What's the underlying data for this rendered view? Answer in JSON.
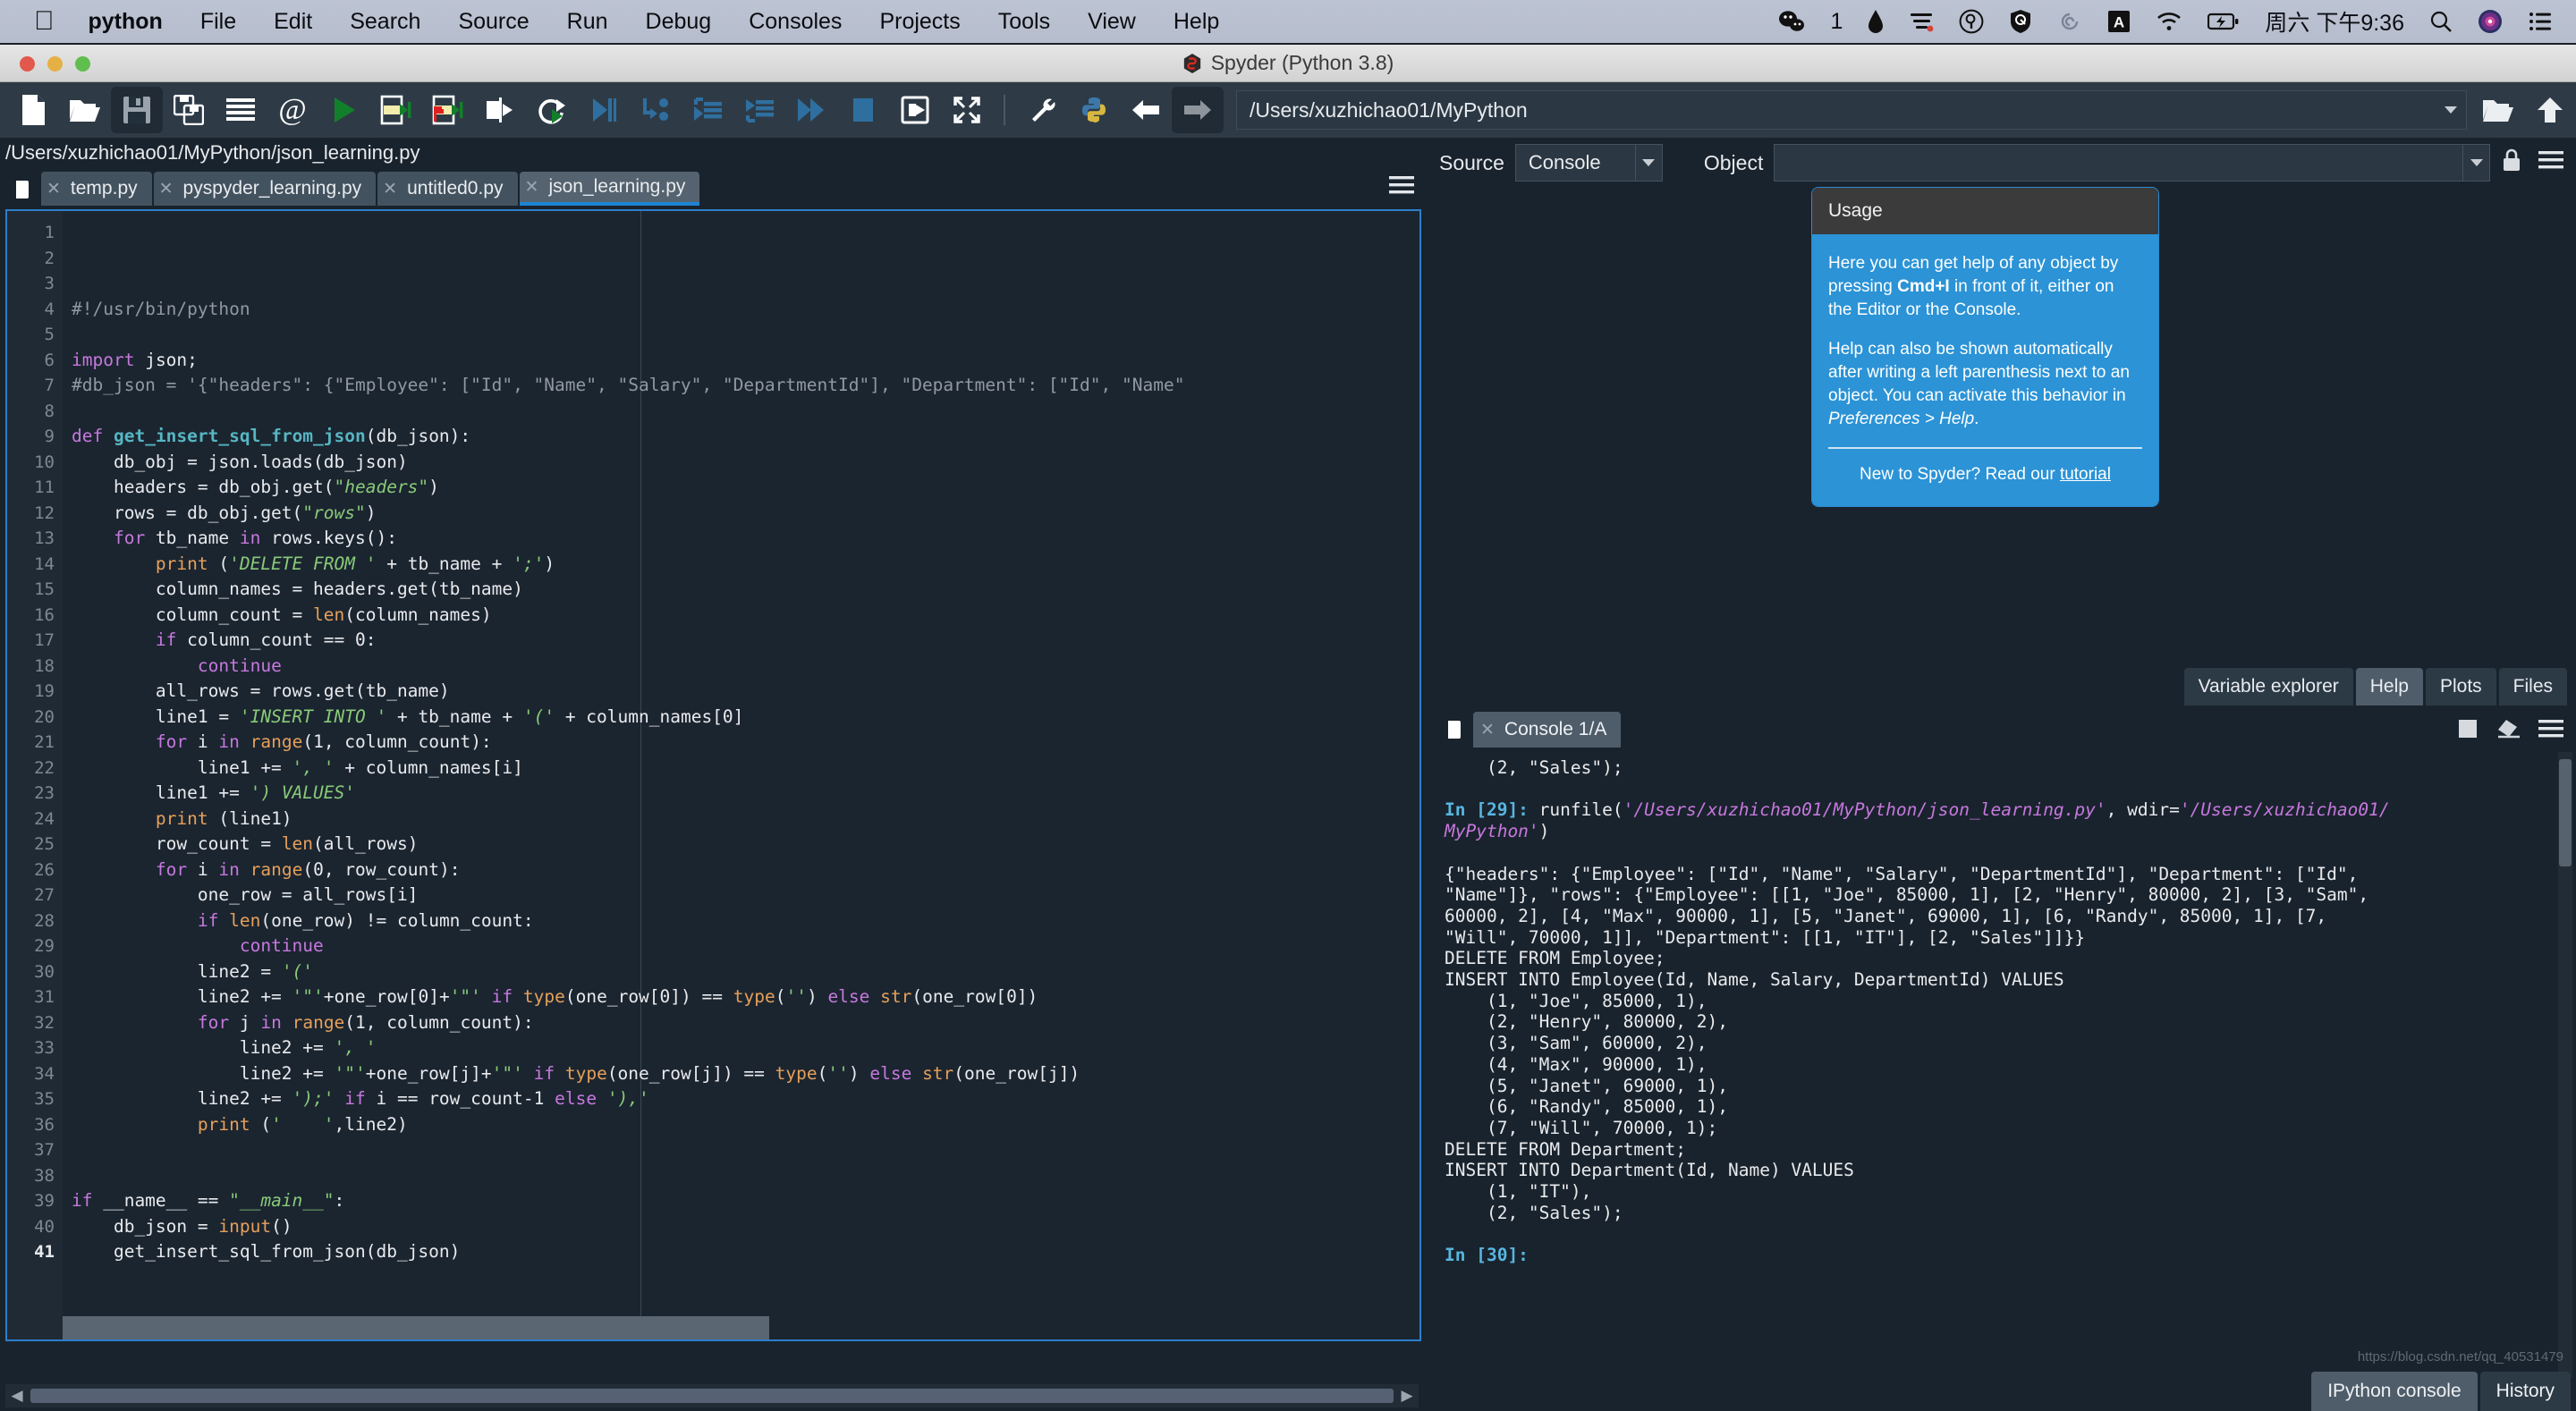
{
  "macos_menubar": {
    "apple_icon": "apple-logo-icon",
    "items": [
      "python",
      "File",
      "Edit",
      "Search",
      "Source",
      "Run",
      "Debug",
      "Consoles",
      "Projects",
      "Tools",
      "View",
      "Help"
    ],
    "tray": {
      "wechat_badge": "1",
      "icons": [
        "wechat-icon",
        "ink-drop-icon",
        "sogou-input-icon",
        "magnifier-badge-icon",
        "shield-icon",
        "spiral-icon",
        "input-source-A-icon",
        "wifi-icon",
        "battery-charging-icon"
      ],
      "clock": "周六 下午9:36",
      "right_icons": [
        "spotlight-search-icon",
        "siri-icon",
        "control-center-icon"
      ]
    }
  },
  "window": {
    "title": "Spyder (Python 3.8)",
    "traffic_lights": [
      "close",
      "minimize",
      "zoom"
    ]
  },
  "toolbar": {
    "buttons": [
      "new-file-icon",
      "open-file-icon",
      "save-file-icon",
      "save-all-icon",
      "file-switcher-icon",
      "find-symbol-icon",
      "run-file-icon",
      "run-cell-icon",
      "run-cell-advance-icon",
      "run-selection-icon",
      "rerun-last-cell-icon",
      "debug-file-icon",
      "step-into-icon",
      "step-return-icon",
      "step-over-icon",
      "continue-icon",
      "stop-debug-icon",
      "debug-exit-icon",
      "maximize-pane-icon",
      "preferences-icon",
      "pythonpath-manager-icon"
    ],
    "save_pressed": true,
    "back_icon": "back-arrow-icon",
    "forward_icon": "forward-arrow-icon",
    "path_value": "/Users/xuzhichao01/MyPython",
    "browse_icon": "browse-folder-icon",
    "parent_icon": "parent-directory-icon"
  },
  "editor": {
    "file_path": "/Users/xuzhichao01/MyPython/json_learning.py",
    "browse_tabs_icon": "file-browser-icon",
    "options_icon": "hamburger-menu-icon",
    "tabs": [
      {
        "label": "temp.py",
        "active": false
      },
      {
        "label": "pyspyder_learning.py",
        "active": false
      },
      {
        "label": "untitled0.py",
        "active": false
      },
      {
        "label": "json_learning.py",
        "active": true
      }
    ],
    "current_line": 41,
    "total_lines": 41,
    "code_lines": [
      {
        "n": 1,
        "html": "<span class='cm'>#!/usr/bin/python</span>"
      },
      {
        "n": 2,
        "html": ""
      },
      {
        "n": 3,
        "html": "<span class='k'>import</span> <span class='nm'>json</span>;"
      },
      {
        "n": 4,
        "html": "<span class='cm'>#db_json = '{\"headers\": {\"Employee\": [\"Id\", \"Name\", \"Salary\", \"DepartmentId\"], \"Department\": [\"Id\", \"Name\"</span>"
      },
      {
        "n": 5,
        "html": ""
      },
      {
        "n": 6,
        "html": "<span class='k'>def</span> <span class='fn'>get_insert_sql_from_json</span>(db_json):"
      },
      {
        "n": 7,
        "html": "    db_obj = json.loads(db_json)"
      },
      {
        "n": 8,
        "html": "    headers = db_obj.get(<span class='st'>\"headers\"</span>)"
      },
      {
        "n": 9,
        "html": "    rows = db_obj.get(<span class='st'>\"rows\"</span>)"
      },
      {
        "n": 10,
        "html": "    <span class='k'>for</span> tb_name <span class='k'>in</span> rows.keys():"
      },
      {
        "n": 11,
        "html": "        <span class='bi'>print</span> (<span class='st'>'DELETE FROM '</span> + tb_name + <span class='st'>';'</span>)"
      },
      {
        "n": 12,
        "html": "        column_names = headers.get(tb_name)"
      },
      {
        "n": 13,
        "html": "        column_count = <span class='bi'>len</span>(column_names)"
      },
      {
        "n": 14,
        "html": "        <span class='k'>if</span> column_count == <span class='num'>0</span>:"
      },
      {
        "n": 15,
        "html": "            <span class='k'>continue</span>"
      },
      {
        "n": 16,
        "html": "        all_rows = rows.get(tb_name)"
      },
      {
        "n": 17,
        "html": "        line1 = <span class='st'>'INSERT INTO '</span> + tb_name + <span class='st'>'('</span> + column_names[<span class='num'>0</span>]"
      },
      {
        "n": 18,
        "html": "        <span class='k'>for</span> i <span class='k'>in</span> <span class='bi'>range</span>(<span class='num'>1</span>, column_count):"
      },
      {
        "n": 19,
        "html": "            line1 += <span class='st'>', '</span> + column_names[i]"
      },
      {
        "n": 20,
        "html": "        line1 += <span class='st'>') VALUES'</span>"
      },
      {
        "n": 21,
        "html": "        <span class='bi'>print</span> (line1)"
      },
      {
        "n": 22,
        "html": "        row_count = <span class='bi'>len</span>(all_rows)"
      },
      {
        "n": 23,
        "html": "        <span class='k'>for</span> i <span class='k'>in</span> <span class='bi'>range</span>(<span class='num'>0</span>, row_count):"
      },
      {
        "n": 24,
        "html": "            one_row = all_rows[i]"
      },
      {
        "n": 25,
        "html": "            <span class='k'>if</span> <span class='bi'>len</span>(one_row) != column_count:"
      },
      {
        "n": 26,
        "html": "                <span class='k'>continue</span>"
      },
      {
        "n": 27,
        "html": "            line2 = <span class='st'>'('</span>"
      },
      {
        "n": 28,
        "html": "            line2 += <span class='st'>'\"'</span>+one_row[<span class='num'>0</span>]+<span class='st'>'\"'</span> <span class='k'>if</span> <span class='bi'>type</span>(one_row[<span class='num'>0</span>]) == <span class='bi'>type</span>(<span class='st'>''</span>) <span class='k'>else</span> <span class='bi'>str</span>(one_row[<span class='num'>0</span>])"
      },
      {
        "n": 29,
        "html": "            <span class='k'>for</span> j <span class='k'>in</span> <span class='bi'>range</span>(<span class='num'>1</span>, column_count):"
      },
      {
        "n": 30,
        "html": "                line2 += <span class='st'>', '</span>"
      },
      {
        "n": 31,
        "html": "                line2 += <span class='st'>'\"'</span>+one_row[j]+<span class='st'>'\"'</span> <span class='k'>if</span> <span class='bi'>type</span>(one_row[j]) == <span class='bi'>type</span>(<span class='st'>''</span>) <span class='k'>else</span> <span class='bi'>str</span>(one_row[j])"
      },
      {
        "n": 32,
        "html": "            line2 += <span class='st'>');'</span> <span class='k'>if</span> i == row_count-<span class='num'>1</span> <span class='k'>else</span> <span class='st'>'),'</span>"
      },
      {
        "n": 33,
        "html": "            <span class='bi'>print</span> (<span class='st'>'    '</span>,line2)"
      },
      {
        "n": 34,
        "html": ""
      },
      {
        "n": 35,
        "html": ""
      },
      {
        "n": 36,
        "html": "<span class='k'>if</span> __name__ == <span class='st'>\"__main__\"</span>:"
      },
      {
        "n": 37,
        "html": "    db_json = <span class='bi'>input</span>()"
      },
      {
        "n": 38,
        "html": "    get_insert_sql_from_json(db_json)"
      },
      {
        "n": 39,
        "html": ""
      },
      {
        "n": 40,
        "html": ""
      },
      {
        "n": 41,
        "html": ""
      }
    ]
  },
  "help_panel": {
    "source_label": "Source",
    "source_value": "Console",
    "object_label": "Object",
    "object_value": "",
    "lock_icon": "lock-icon",
    "options_icon": "hamburger-menu-icon",
    "usage": {
      "title": "Usage",
      "paragraph1_pre": "Here you can get help of any object by pressing ",
      "paragraph1_bold": "Cmd+I",
      "paragraph1_post": " in front of it, either on the Editor or the Console.",
      "paragraph2_pre": "Help can also be shown automatically after writing a left parenthesis next to an object. You can activate this behavior in ",
      "paragraph2_italic": "Preferences > Help",
      "paragraph2_post": ".",
      "footer_pre": "New to Spyder? Read our ",
      "footer_link": "tutorial"
    },
    "tabs": [
      {
        "label": "Variable explorer",
        "active": false
      },
      {
        "label": "Help",
        "active": true
      },
      {
        "label": "Plots",
        "active": false
      },
      {
        "label": "Files",
        "active": false
      }
    ]
  },
  "console_panel": {
    "browse_icon": "file-browser-icon",
    "tab_label": "Console 1/A",
    "icons": [
      "stop-icon",
      "clear-console-icon",
      "hamburger-menu-icon"
    ],
    "output_lines": [
      {
        "html": "    (2, \"Sales\");"
      },
      {
        "html": ""
      },
      {
        "html": "<span class='in'>In [29]:</span> runfile(<span class='pth'>'/Users/xuzhichao01/MyPython/json_learning.py'</span>, wdir=<span class='pth'>'/Users/xuzhichao01/</span>"
      },
      {
        "html": "<span class='pth'>MyPython'</span>)"
      },
      {
        "html": ""
      },
      {
        "html": "{\"headers\": {\"Employee\": [\"Id\", \"Name\", \"Salary\", \"DepartmentId\"], \"Department\": [\"Id\","
      },
      {
        "html": "\"Name\"]}, \"rows\": {\"Employee\": [[1, \"Joe\", 85000, 1], [2, \"Henry\", 80000, 2], [3, \"Sam\","
      },
      {
        "html": "60000, 2], [4, \"Max\", 90000, 1], [5, \"Janet\", 69000, 1], [6, \"Randy\", 85000, 1], [7,"
      },
      {
        "html": "\"Will\", 70000, 1]], \"Department\": [[1, \"IT\"], [2, \"Sales\"]]}}"
      },
      {
        "html": "DELETE FROM Employee;"
      },
      {
        "html": "INSERT INTO Employee(Id, Name, Salary, DepartmentId) VALUES"
      },
      {
        "html": "    (1, \"Joe\", 85000, 1),"
      },
      {
        "html": "    (2, \"Henry\", 80000, 2),"
      },
      {
        "html": "    (3, \"Sam\", 60000, 2),"
      },
      {
        "html": "    (4, \"Max\", 90000, 1),"
      },
      {
        "html": "    (5, \"Janet\", 69000, 1),"
      },
      {
        "html": "    (6, \"Randy\", 85000, 1),"
      },
      {
        "html": "    (7, \"Will\", 70000, 1);"
      },
      {
        "html": "DELETE FROM Department;"
      },
      {
        "html": "INSERT INTO Department(Id, Name) VALUES"
      },
      {
        "html": "    (1, \"IT\"),"
      },
      {
        "html": "    (2, \"Sales\");"
      },
      {
        "html": ""
      },
      {
        "html": "<span class='in'>In [30]:</span>"
      }
    ],
    "tabs": [
      {
        "label": "IPython console",
        "active": true
      },
      {
        "label": "History",
        "active": false
      }
    ],
    "watermark": "https://blog.csdn.net/qq_40531479"
  },
  "colors": {
    "window_chrome": "#2e3b47",
    "editor_bg": "#1b2530",
    "panel_bg": "#19232d",
    "accent_blue": "#2d7fc9",
    "usage_blue": "#2b93d6",
    "tab_active": "#4f5d6a"
  }
}
